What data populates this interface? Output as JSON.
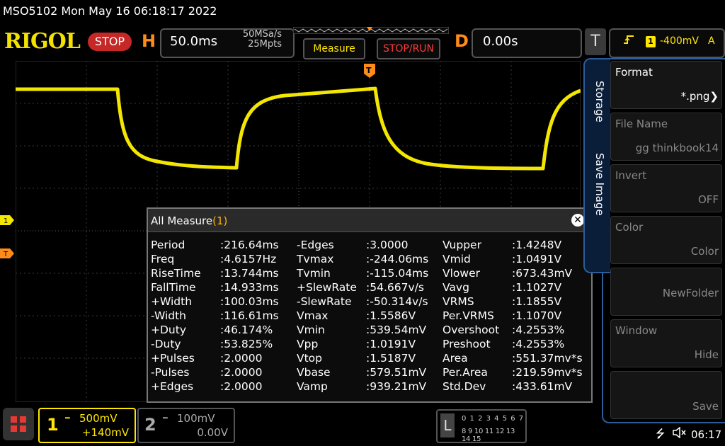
{
  "title_bar": {
    "text": "MSO5102  Mon May 16 06:18:17 2022"
  },
  "header": {
    "logo": "RIGOL",
    "run_state": "STOP",
    "horizontal": {
      "letter": "H",
      "timebase": "50.0ms",
      "sample_rate": "50MSa/s",
      "memory_depth": "25Mpts"
    },
    "measure_label": "Measure",
    "stoprun_label": "STOP/RUN",
    "delay": {
      "letter": "D",
      "value": "0.00s"
    },
    "trigger": {
      "letter": "T",
      "edge_icon": "rising-edge-icon",
      "source": "1",
      "level": "-400mV",
      "mode": "A"
    }
  },
  "waveform": {
    "channel_color": "#f3e600",
    "ch1_marker": "1",
    "trig_marker": "T"
  },
  "measure_panel": {
    "title": "All Measure",
    "count": "(1)",
    "columns": [
      [
        {
          "label": "Period",
          "value": ":216.64ms"
        },
        {
          "label": "Freq",
          "value": ":4.6157Hz"
        },
        {
          "label": "RiseTime",
          "value": ":13.744ms"
        },
        {
          "label": "FallTime",
          "value": ":14.933ms"
        },
        {
          "label": "+Width",
          "value": ":100.03ms"
        },
        {
          "label": "-Width",
          "value": ":116.61ms"
        },
        {
          "label": "+Duty",
          "value": ":46.174%"
        },
        {
          "label": "-Duty",
          "value": ":53.825%"
        },
        {
          "label": "+Pulses",
          "value": ":2.0000"
        },
        {
          "label": "-Pulses",
          "value": ":2.0000"
        },
        {
          "label": "+Edges",
          "value": ":2.0000"
        }
      ],
      [
        {
          "label": "-Edges",
          "value": ":3.0000"
        },
        {
          "label": "Tvmax",
          "value": ":-244.06ms"
        },
        {
          "label": "Tvmin",
          "value": ":-115.04ms"
        },
        {
          "label": "+SlewRate",
          "value": ":54.667v/s"
        },
        {
          "label": "-SlewRate",
          "value": ":-50.314v/s"
        },
        {
          "label": "Vmax",
          "value": ":1.5586V"
        },
        {
          "label": "Vmin",
          "value": ":539.54mV"
        },
        {
          "label": "Vpp",
          "value": ":1.0191V"
        },
        {
          "label": "Vtop",
          "value": ":1.5187V"
        },
        {
          "label": "Vbase",
          "value": ":579.51mV"
        },
        {
          "label": "Vamp",
          "value": ":939.21mV"
        }
      ],
      [
        {
          "label": "Vupper",
          "value": ":1.4248V"
        },
        {
          "label": "Vmid",
          "value": ":1.0491V"
        },
        {
          "label": "Vlower",
          "value": ":673.43mV"
        },
        {
          "label": "Vavg",
          "value": ":1.1027V"
        },
        {
          "label": "VRMS",
          "value": ":1.1855V"
        },
        {
          "label": "Per.VRMS",
          "value": ":1.1070V"
        },
        {
          "label": "Overshoot",
          "value": ":4.2553%"
        },
        {
          "label": "Preshoot",
          "value": ":4.2553%"
        },
        {
          "label": "Area",
          "value": ":551.37mv*s"
        },
        {
          "label": "Per.Area",
          "value": ":219.59mv*s"
        },
        {
          "label": "Std.Dev",
          "value": ":433.61mV"
        }
      ]
    ]
  },
  "side_menu": {
    "tabs": [
      "Storage",
      "Save Image"
    ],
    "softkeys": [
      {
        "title": "Format",
        "value": "*.png"
      },
      {
        "title": "File Name",
        "value": "gg thinkbook14"
      },
      {
        "title": "Invert",
        "value": "OFF"
      },
      {
        "title": "Color",
        "value": "Color"
      },
      {
        "title": "",
        "value": "NewFolder"
      },
      {
        "title": "Window",
        "value": "Hide"
      },
      {
        "title": "",
        "value": "Save"
      }
    ]
  },
  "bottom_bar": {
    "ch1": {
      "num": "1",
      "scale": "500mV",
      "offset": "+140mV"
    },
    "ch2": {
      "num": "2",
      "scale": "100mV",
      "offset": "0.00V"
    },
    "la": {
      "letter": "L",
      "row1": "0 1 2 3  4 5 6 7",
      "row2": "8 9 10 11 12 13 14 15"
    },
    "time": "06:17"
  }
}
